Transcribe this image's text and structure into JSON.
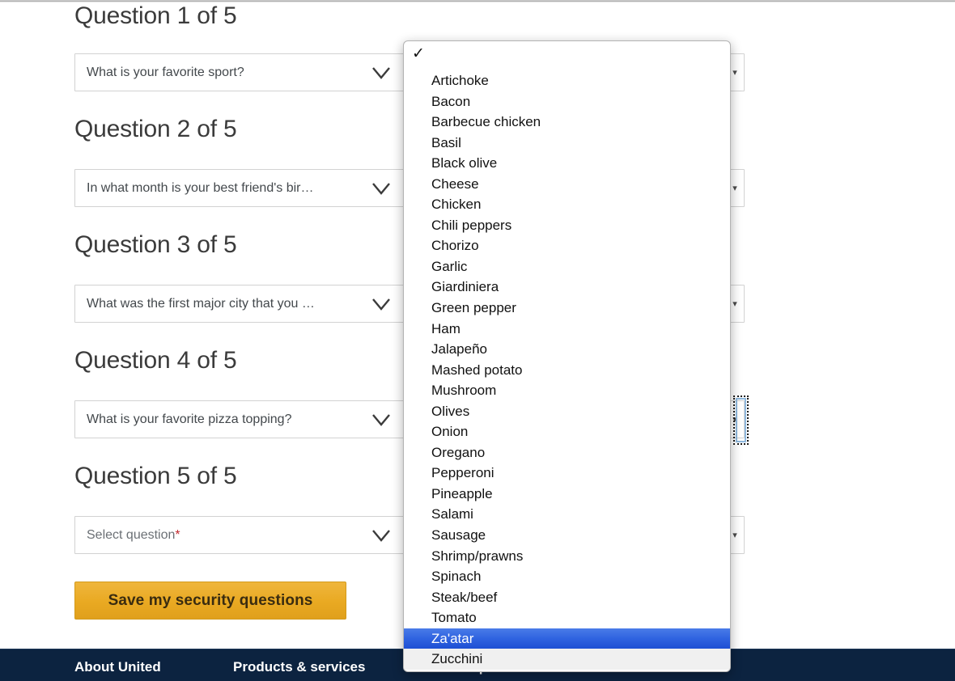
{
  "page": {
    "questions": [
      {
        "heading": "Question 1 of 5",
        "value": "What is your favorite sport?",
        "is_placeholder": false
      },
      {
        "heading": "Question 2 of 5",
        "value": "In what month is your best friend's bir…",
        "is_placeholder": false
      },
      {
        "heading": "Question 3 of 5",
        "value": "What was the first major city that you …",
        "is_placeholder": false
      },
      {
        "heading": "Question 4 of 5",
        "value": "What is your favorite pizza topping?",
        "is_placeholder": false
      },
      {
        "heading": "Question 5 of 5",
        "value": "Select question",
        "is_placeholder": true,
        "required_marker": "*"
      }
    ],
    "save_button_label": "Save my security questions",
    "chevron_icon": "chevron-down-icon",
    "native_arrow_glyph": "▾"
  },
  "dropdown": {
    "check_glyph": "✓",
    "selected_option": "Za'atar",
    "highlight_color": "#2f63e0",
    "options": [
      "Artichoke",
      "Bacon",
      "Barbecue chicken",
      "Basil",
      "Black olive",
      "Cheese",
      "Chicken",
      "Chili peppers",
      "Chorizo",
      "Garlic",
      "Giardiniera",
      "Green pepper",
      "Ham",
      "Jalapeño",
      "Mashed potato",
      "Mushroom",
      "Olives",
      "Onion",
      "Oregano",
      "Pepperoni",
      "Pineapple",
      "Salami",
      "Sausage",
      "Shrimp/prawns",
      "Spinach",
      "Steak/beef",
      "Tomato",
      "Za'atar",
      "Zucchini"
    ]
  },
  "footer": {
    "background_color": "#0c2340",
    "links": [
      "About United",
      "Products & services",
      "Popular destinations"
    ]
  }
}
